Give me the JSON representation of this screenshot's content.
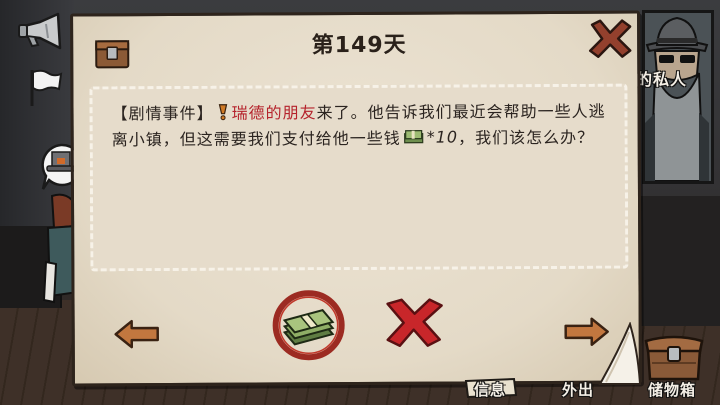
{
  "hud": {
    "megaphone_icon": "megaphone-icon",
    "flag_icon": "white-flag-icon",
    "speech_bubble_icon": "top-hat-speech-bubble-icon",
    "portrait_label": "的私人"
  },
  "dialog": {
    "title": "第149天",
    "chest_icon": "chest-icon",
    "close_icon": "close-x-icon",
    "event": {
      "tag": "【剧情事件】",
      "tag_icon": "exclamation-icon",
      "character_name": "瑞德的朋友",
      "line1_rest": "来了。他告诉我们最近会帮助一些人逃",
      "line2_start": "离小镇，但这需要我们支付给他一些钱",
      "cost_icon": "money-icon",
      "cost": "*10",
      "line2_end": "，我们该怎么办？"
    },
    "actions": {
      "prev_icon": "arrow-left-icon",
      "accept_icon": "money-stack-icon",
      "reject_icon": "red-x-icon",
      "next_icon": "arrow-right-icon"
    }
  },
  "bottom_nav": [
    {
      "label": "信息",
      "icon": "scroll-icon"
    },
    {
      "label": "外出"
    },
    {
      "label": "储物箱",
      "icon": "chest-icon"
    }
  ],
  "colors": {
    "paper": "#e4dac7",
    "paper_border": "#2e241c",
    "text": "#2b2420",
    "character_name": "#b5232c",
    "reject": "#c8262a",
    "accept_ring": "#9c2b22"
  }
}
